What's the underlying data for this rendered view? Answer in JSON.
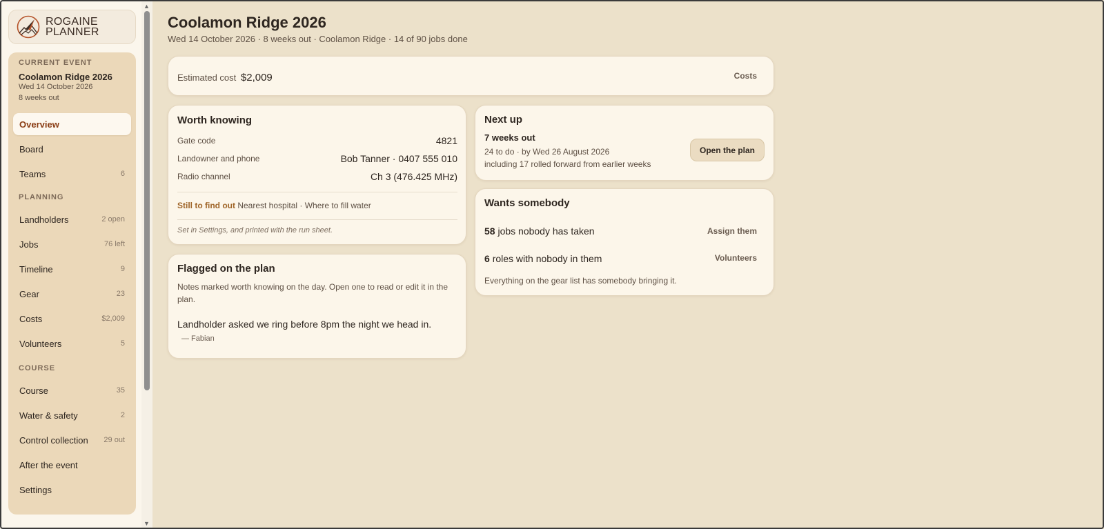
{
  "brand": {
    "line1": "ROGAINE",
    "line2": "PLANNER",
    "logo_icon": "compass-mountain-icon"
  },
  "sidebar": {
    "current_event_label": "CURRENT EVENT",
    "event_name": "Coolamon Ridge 2026",
    "event_date": "Wed 14 October 2026",
    "event_countdown": "8 weeks out",
    "top_items": [
      {
        "label": "Overview",
        "count": "",
        "active": true
      },
      {
        "label": "Board",
        "count": ""
      },
      {
        "label": "Teams",
        "count": "6"
      }
    ],
    "planning_label": "PLANNING",
    "planning_items": [
      {
        "label": "Landholders",
        "count": "2 open"
      },
      {
        "label": "Jobs",
        "count": "76 left"
      },
      {
        "label": "Timeline",
        "count": "9"
      },
      {
        "label": "Gear",
        "count": "23"
      },
      {
        "label": "Costs",
        "count": "$2,009"
      },
      {
        "label": "Volunteers",
        "count": "5"
      }
    ],
    "course_label": "COURSE",
    "course_items": [
      {
        "label": "Course",
        "count": "35"
      },
      {
        "label": "Water & safety",
        "count": "2"
      },
      {
        "label": "Control collection",
        "count": "29 out"
      },
      {
        "label": "After the event",
        "count": ""
      },
      {
        "label": "Settings",
        "count": ""
      }
    ]
  },
  "header": {
    "title": "Coolamon Ridge 2026",
    "subtitle": "Wed 14 October 2026 · 8 weeks out · Coolamon Ridge · 14 of 90 jobs done"
  },
  "cost": {
    "label": "Estimated cost",
    "value": "$2,009",
    "link": "Costs"
  },
  "worth_knowing": {
    "title": "Worth knowing",
    "rows": [
      {
        "label": "Gate code",
        "value": "4821"
      },
      {
        "label": "Landowner and phone",
        "value": "Bob Tanner · 0407 555 010"
      },
      {
        "label": "Radio channel",
        "value": "Ch 3 (476.425 MHz)"
      }
    ],
    "still_label": "Still to find out",
    "still_items": "Nearest hospital · Where to fill water",
    "footnote": "Set in Settings, and printed with the run sheet."
  },
  "flagged": {
    "title": "Flagged on the plan",
    "description": "Notes marked worth knowing on the day. Open one to read or edit it in the plan.",
    "quote": "Landholder asked we ring before 8pm the night we head in.",
    "author": "— Fabian"
  },
  "next_up": {
    "title": "Next up",
    "heading": "7 weeks out",
    "line1": "24 to do · by Wed 26 August 2026",
    "line2": "including 17 rolled forward from earlier weeks",
    "button": "Open the plan"
  },
  "wants": {
    "title": "Wants somebody",
    "jobs_count": "58",
    "jobs_text": "jobs nobody has taken",
    "jobs_link": "Assign them",
    "roles_count": "6",
    "roles_text": "roles with nobody in them",
    "roles_link": "Volunteers",
    "gear_note": "Everything on the gear list has somebody bringing it."
  }
}
